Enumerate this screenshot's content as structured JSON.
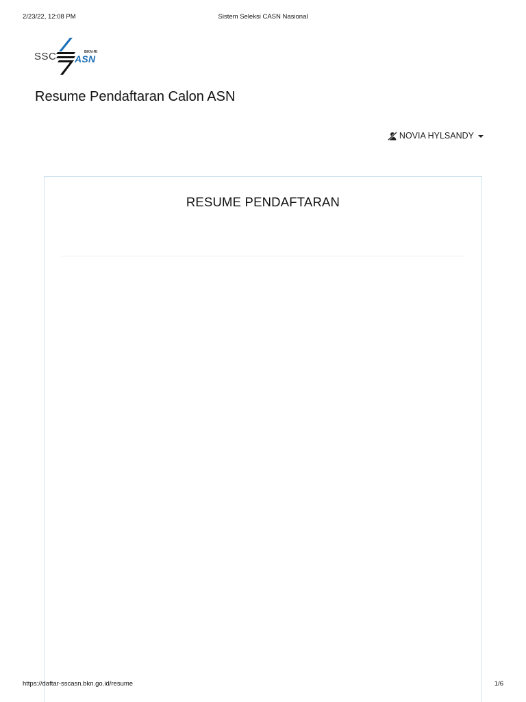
{
  "print_header": {
    "datetime": "2/23/22, 12:08 PM",
    "document_title": "Sistem Seleksi CASN Nasional"
  },
  "logo": {
    "ssc_text": "SSC",
    "bkn_text": "BKN-RI",
    "asn_text": "ASN",
    "icon": "sscasn-logo-mark",
    "brand_color": "#1d6fb8"
  },
  "page": {
    "title": "Resume Pendaftaran Calon ASN"
  },
  "user_menu": {
    "icon": "user-slash-icon",
    "name": "NOVIA HYLSANDY"
  },
  "panel": {
    "heading": "RESUME PENDAFTARAN",
    "border_color": "#cfe3ec"
  },
  "print_footer": {
    "url": "https://daftar-sscasn.bkn.go.id/resume",
    "page_number": "1/6"
  }
}
